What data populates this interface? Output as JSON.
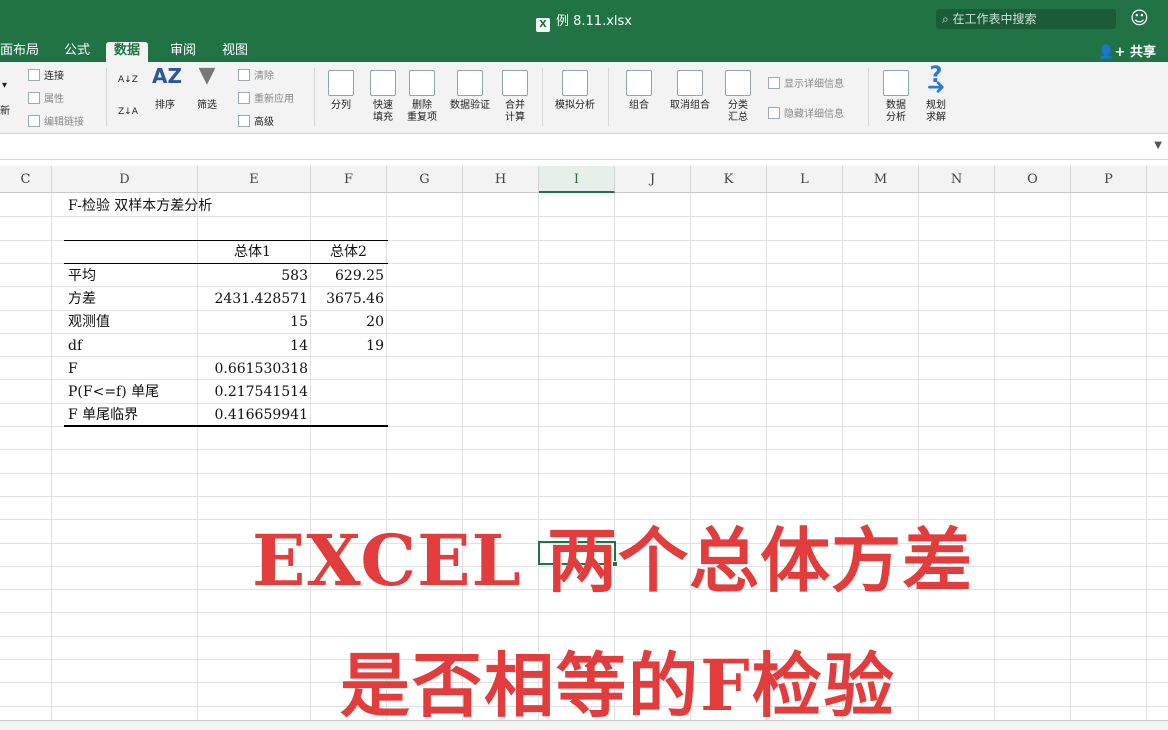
{
  "window": {
    "title": "例 8.11.xlsx",
    "file_icon": "excel-icon",
    "search_placeholder": "在工作表中搜索"
  },
  "tabs": [
    {
      "label": "面布局",
      "active": false
    },
    {
      "label": "公式",
      "active": false
    },
    {
      "label": "数据",
      "active": true
    },
    {
      "label": "审阅",
      "active": false
    },
    {
      "label": "视图",
      "active": false
    }
  ],
  "share_label": "共享",
  "ribbon": {
    "left_cut": {
      "dropdown": "▾",
      "refresh": "新"
    },
    "connections": {
      "connect": "连接",
      "properties": "属性",
      "edit_links": "编辑链接"
    },
    "sort": {
      "sort": "排序",
      "az": "A↓Z",
      "za": "Z↓A"
    },
    "filter": {
      "filter": "筛选",
      "clear": "清除",
      "reapply": "重新应用",
      "advanced": "高级"
    },
    "tools": {
      "split": "分列",
      "flash_fill": "快速\n填充",
      "remove_dup": "删除\n重复项",
      "validation": "数据验证",
      "consolidate": "合并\n计算"
    },
    "whatif": "模拟分析",
    "outline": {
      "group": "组合",
      "ungroup": "取消组合",
      "subtotal": "分类\n汇总",
      "show_detail": "显示详细信息",
      "hide_detail": "隐藏详细信息"
    },
    "analysis": {
      "data_analysis": "数据\n分析",
      "solver": "规划\n求解"
    }
  },
  "columns": [
    "C",
    "D",
    "E",
    "F",
    "G",
    "H",
    "I",
    "J",
    "K",
    "L",
    "M",
    "N",
    "O",
    "P"
  ],
  "selected_column": "I",
  "sheet": {
    "title": "F-检验 双样本方差分析",
    "headers": [
      "总体1",
      "总体2"
    ],
    "rows": [
      {
        "label": "平均",
        "v1": "583",
        "v2": "629.25"
      },
      {
        "label": "方差",
        "v1": "2431.428571",
        "v2": "3675.46"
      },
      {
        "label": "观测值",
        "v1": "15",
        "v2": "20"
      },
      {
        "label": "df",
        "v1": "14",
        "v2": "19"
      },
      {
        "label": "F",
        "v1": "0.661530318",
        "v2": ""
      },
      {
        "label": "P(F<=f) 单尾",
        "v1": "0.217541514",
        "v2": ""
      },
      {
        "label": "F 单尾临界",
        "v1": "0.416659941",
        "v2": ""
      }
    ]
  },
  "overlay": {
    "line1": "EXCEL 两个总体方差",
    "line2": "是否相等的F检验"
  }
}
